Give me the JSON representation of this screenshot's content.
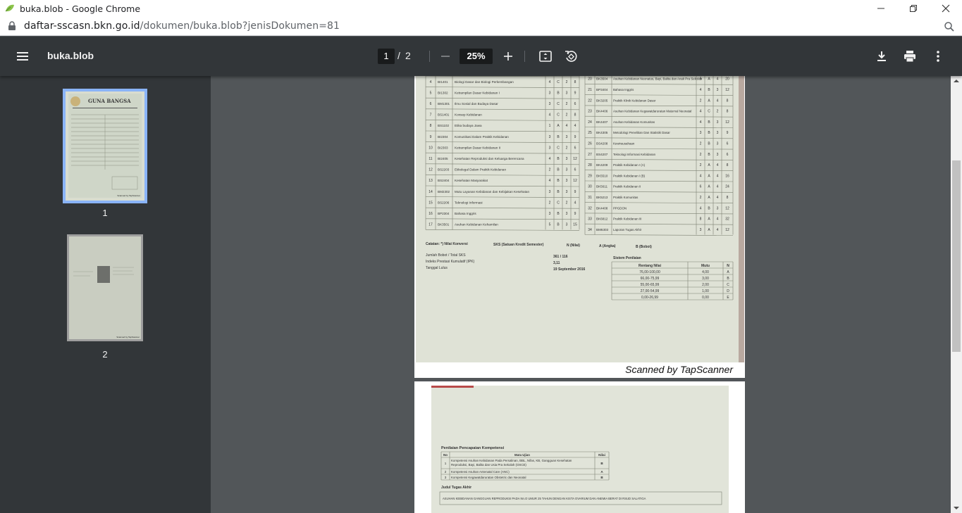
{
  "window": {
    "title": "buka.blob - Google Chrome",
    "url_host": "daftar-sscasn.bkn.go.id",
    "url_path": "/dokumen/buka.blob?jenisDokumen=81"
  },
  "toolbar": {
    "title": "buka.blob",
    "current_page": "1",
    "separator": "/",
    "total_pages": "2",
    "zoom": "25%"
  },
  "sidebar": {
    "thumbnails": [
      {
        "label": "1",
        "selected": true
      },
      {
        "label": "2",
        "selected": false
      }
    ]
  },
  "page1": {
    "footer": "Scanned by TapScanner",
    "left_rows": [
      {
        "no": "4",
        "code": "BI1401",
        "name": "Biologi Dasar dan Biologi Perkembangan",
        "sks": "4",
        "n": "C",
        "a": "2",
        "b": "8"
      },
      {
        "no": "5",
        "code": "BI1302",
        "name": "Ketrampilan Dasar Kebidanan I",
        "sks": "3",
        "n": "B",
        "a": "3",
        "b": "9"
      },
      {
        "no": "6",
        "code": "BM1301",
        "name": "Ilmu Sosial dan Budaya Dasar",
        "sks": "3",
        "n": "C",
        "a": "2",
        "b": "6"
      },
      {
        "no": "7",
        "code": "BS1401",
        "name": "Konsep Kebidanan",
        "sks": "4",
        "n": "C",
        "a": "2",
        "b": "8"
      },
      {
        "no": "8",
        "code": "BS1102",
        "name": "Etika budaya Jawa",
        "sks": "1",
        "n": "A",
        "a": "4",
        "b": "4"
      },
      {
        "no": "9",
        "code": "BI2304",
        "name": "Komunikasi Dalam Praktik Kebidanan",
        "sks": "3",
        "n": "B",
        "a": "3",
        "b": "9"
      },
      {
        "no": "10",
        "code": "BI2303",
        "name": "Ketrampilan Dasar Kebidanan II",
        "sks": "3",
        "n": "C",
        "a": "2",
        "b": "6"
      },
      {
        "no": "11",
        "code": "BI2405",
        "name": "Kesehatan Reproduksi dan Keluarga Berencana",
        "sks": "4",
        "n": "B",
        "a": "3",
        "b": "12"
      },
      {
        "no": "12",
        "code": "BS2203",
        "name": "Etikolegal Dalam Praktik Kebidanan",
        "sks": "2",
        "n": "B",
        "a": "3",
        "b": "6"
      },
      {
        "no": "13",
        "code": "BS2404",
        "name": "Kesehatan Masyarakat",
        "sks": "4",
        "n": "B",
        "a": "3",
        "b": "12"
      },
      {
        "no": "14",
        "code": "BM2302",
        "name": "Mutu Layanan Kebidanan dan Kebijakan Kesehatan",
        "sks": "3",
        "n": "B",
        "a": "3",
        "b": "9"
      },
      {
        "no": "15",
        "code": "BS2206",
        "name": "Teknologi Informasi",
        "sks": "2",
        "n": "C",
        "a": "2",
        "b": "4"
      },
      {
        "no": "16",
        "code": "BP2304",
        "name": "Bahasa Inggris",
        "sks": "3",
        "n": "B",
        "a": "3",
        "b": "9"
      },
      {
        "no": "17",
        "code": "BK3501",
        "name": "Asuhan Kebidanan Kehamilan",
        "sks": "5",
        "n": "B",
        "a": "3",
        "b": "15"
      }
    ],
    "right_rows": [
      {
        "no": "20",
        "code": "BK3504",
        "name": "Asuhan Kebidanan Neonatus, Bayi, Balita dan Anak Pra Sekolah",
        "sks": "5",
        "n": "A",
        "a": "4",
        "b": "20"
      },
      {
        "no": "21",
        "code": "BP3404",
        "name": "Bahasa Inggris",
        "sks": "4",
        "n": "B",
        "a": "3",
        "b": "12"
      },
      {
        "no": "22",
        "code": "BK3205",
        "name": "Praktik Klinik Kebidanan Dasar",
        "sks": "2",
        "n": "A",
        "a": "4",
        "b": "8"
      },
      {
        "no": "23",
        "code": "BK4406",
        "name": "Asuhan Kebidanan Kegawatdaruratan Maternal Neonatal",
        "sks": "4",
        "n": "C",
        "a": "2",
        "b": "8"
      },
      {
        "no": "24",
        "code": "BK4407",
        "name": "Asuhan Kebidanan Komunitas",
        "sks": "4",
        "n": "B",
        "a": "3",
        "b": "12"
      },
      {
        "no": "25",
        "code": "BK4305",
        "name": "Metodologi Penelitian Dan Statistik Dasar",
        "sks": "3",
        "n": "B",
        "a": "3",
        "b": "9"
      },
      {
        "no": "26",
        "code": "BS4208",
        "name": "Kewirausahaan",
        "sks": "2",
        "n": "B",
        "a": "3",
        "b": "6"
      },
      {
        "no": "27",
        "code": "BS4207",
        "name": "Teknologi Informasi Kebidanan",
        "sks": "2",
        "n": "B",
        "a": "3",
        "b": "6"
      },
      {
        "no": "28",
        "code": "BK4209",
        "name": "Praktik Kebidanan I (A)",
        "sks": "2",
        "n": "A",
        "a": "4",
        "b": "8"
      },
      {
        "no": "29",
        "code": "BK5510",
        "name": "Praktik Kebidanan I (B)",
        "sks": "4",
        "n": "A",
        "a": "4",
        "b": "16"
      },
      {
        "no": "30",
        "code": "BK5611",
        "name": "Praktik Kebidanan II",
        "sks": "6",
        "n": "A",
        "a": "4",
        "b": "24"
      },
      {
        "no": "31",
        "code": "BK5213",
        "name": "Praktik Komunitas",
        "sks": "2",
        "n": "A",
        "a": "4",
        "b": "8"
      },
      {
        "no": "32",
        "code": "BK4408",
        "name": "PPGDON",
        "sks": "4",
        "n": "B",
        "a": "3",
        "b": "12"
      },
      {
        "no": "33",
        "code": "BK6812",
        "name": "Praktik Kebidanan III",
        "sks": "8",
        "n": "A",
        "a": "4",
        "b": "32"
      },
      {
        "no": "34",
        "code": "BM6303",
        "name": "Laporan Tugas Akhir",
        "sks": "3",
        "n": "A",
        "a": "4",
        "b": "12"
      }
    ],
    "notes": {
      "catatan": "Catatan: *) Nilai Konversi",
      "sks_note": "SKS (Satuan Kredit Semester)",
      "n_note": "N (Nilai)",
      "a_note": "A (Angka)",
      "b_note": "B (Bobot)",
      "bobot_label": "Jumlah Bobot / Total SKS",
      "bobot_value": "361  /  116",
      "ipk_label": "Indeks Prestasi Kumulatif (IPK)",
      "ipk_value": "3,11",
      "lulus_label": "Tanggal Lulus",
      "lulus_value": "19 September 2016"
    },
    "grading": {
      "title": "Sistem Penilaian",
      "headers": [
        "Rentang Nilai",
        "Mutu",
        "N"
      ],
      "rows": [
        [
          "76,00-100,00",
          "4,00",
          "A"
        ],
        [
          "66,00-75,99",
          "3,00",
          "B"
        ],
        [
          "55,00-65,99",
          "2,00",
          "C"
        ],
        [
          "27,00-54,99",
          "1,00",
          "D"
        ],
        [
          "0,00-26,99",
          "0,00",
          "E"
        ]
      ]
    }
  },
  "page2": {
    "section_title": "Penilaian Pencapaian Kompetensi",
    "headers": [
      "No",
      "Mata Ujian",
      "Nilai"
    ],
    "rows": [
      [
        "1",
        "Kompetensi Asuhan Kebidanan Pada Persalinan, BBL, Nifas, KB, Gangguan Kesehatan Reproduksi, Bayi, Balita dan Usia Pra Sekolah (OSCE)",
        "B"
      ],
      [
        "2",
        "Kompetensi Asuhan Antenatal Care (ANC)",
        "A"
      ],
      [
        "3",
        "Kompetensi Kegawatdaruratan Obstetric dan Neonatal",
        "B"
      ]
    ],
    "thesis_label": "Judul Tugas Akhir",
    "thesis_title": "ASUHAN KEBIDANAN GANGGUAN REPRODUKSI PADA Nn.O UMUR 25 TAHUN DENGAN KISTA OVARIUM DAN ANEMIA BERAT DI RSUD SALATIGA"
  },
  "thumb1": {
    "header": "GUNA BANGSA",
    "footer": "Scanned by TapScanner"
  },
  "thumb2": {
    "footer": "Scanned by TapScanner"
  }
}
